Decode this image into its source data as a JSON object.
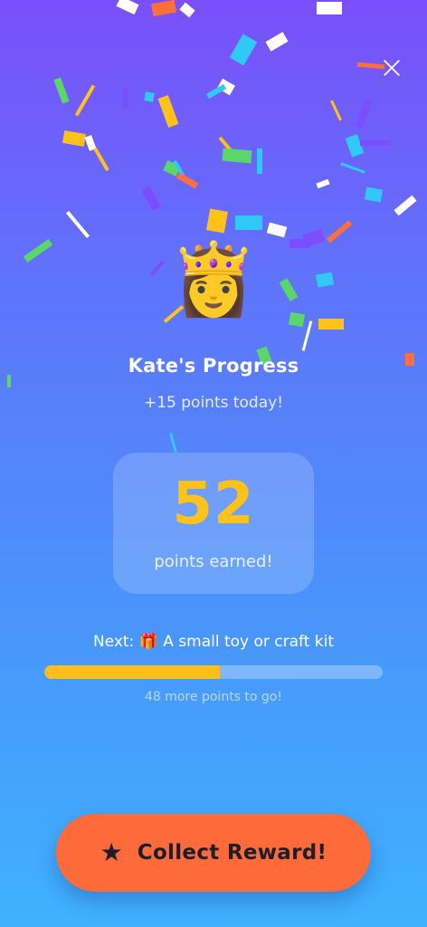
{
  "header": {
    "close_icon": "close-icon"
  },
  "hero": {
    "avatar_emoji": "👸",
    "title": "Kate's Progress",
    "subtitle": "+15 points today!"
  },
  "points": {
    "value": "52",
    "label": "points earned!"
  },
  "next_reward": {
    "text": "Next: 🎁 A small toy or craft kit",
    "progress_fraction": 0.52,
    "remaining_text": "48 more points to go!"
  },
  "actions": {
    "star_icon": "★",
    "collect_label": "Collect Reward!"
  },
  "colors": {
    "gradient_top": "#7a4ffb",
    "gradient_bottom": "#3fb2fd",
    "accent_yellow": "#ffc21a",
    "button": "#fe6a3a",
    "button_text": "#1e1e2a"
  },
  "confetti_colors": [
    "#ffffff",
    "#ffc21a",
    "#30c9f5",
    "#7c4dff",
    "#ff6f3c",
    "#5bd66a",
    "#2aa8ff"
  ]
}
